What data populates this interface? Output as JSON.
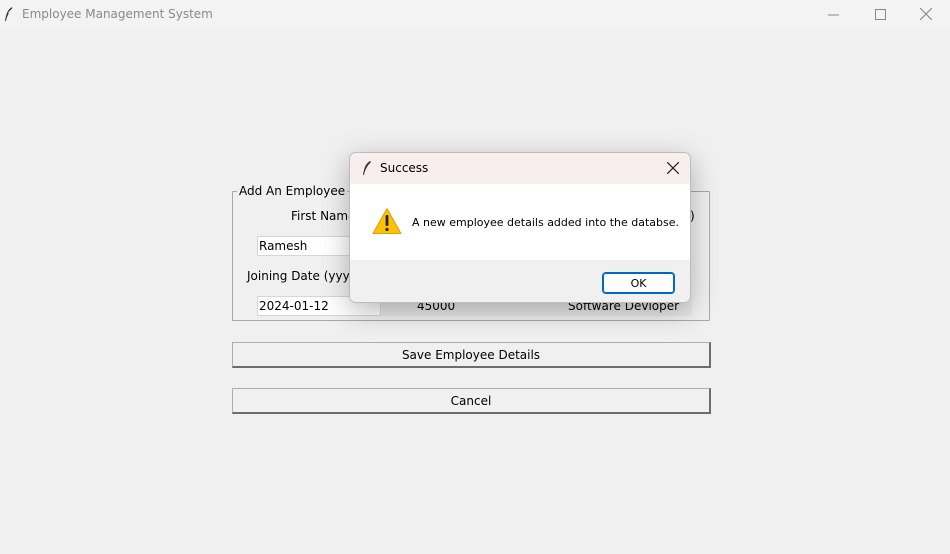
{
  "window": {
    "title": "Employee Management System",
    "controls": {
      "minimize": "minimize-icon",
      "maximize": "maximize-icon",
      "close": "close-icon"
    }
  },
  "form": {
    "frame_title": "Add An Employee",
    "first_name_label": "First Name",
    "first_name_value": "Ramesh",
    "joining_date_label": "Joining Date (yyyy-",
    "joining_date_value": "2024-01-12",
    "salary_value": "45000",
    "designation_value": "Software Devloper",
    "hidden_label_tail": ")"
  },
  "buttons": {
    "save_label": "Save Employee Details",
    "cancel_label": "Cancel"
  },
  "dialog": {
    "title": "Success",
    "message": "A new employee details added into the databse.",
    "ok_label": "OK",
    "icon": "warning-icon"
  },
  "colors": {
    "accent": "#0067c0",
    "warning": "#ffc107",
    "dialog_titlebar": "#f9eeee"
  }
}
